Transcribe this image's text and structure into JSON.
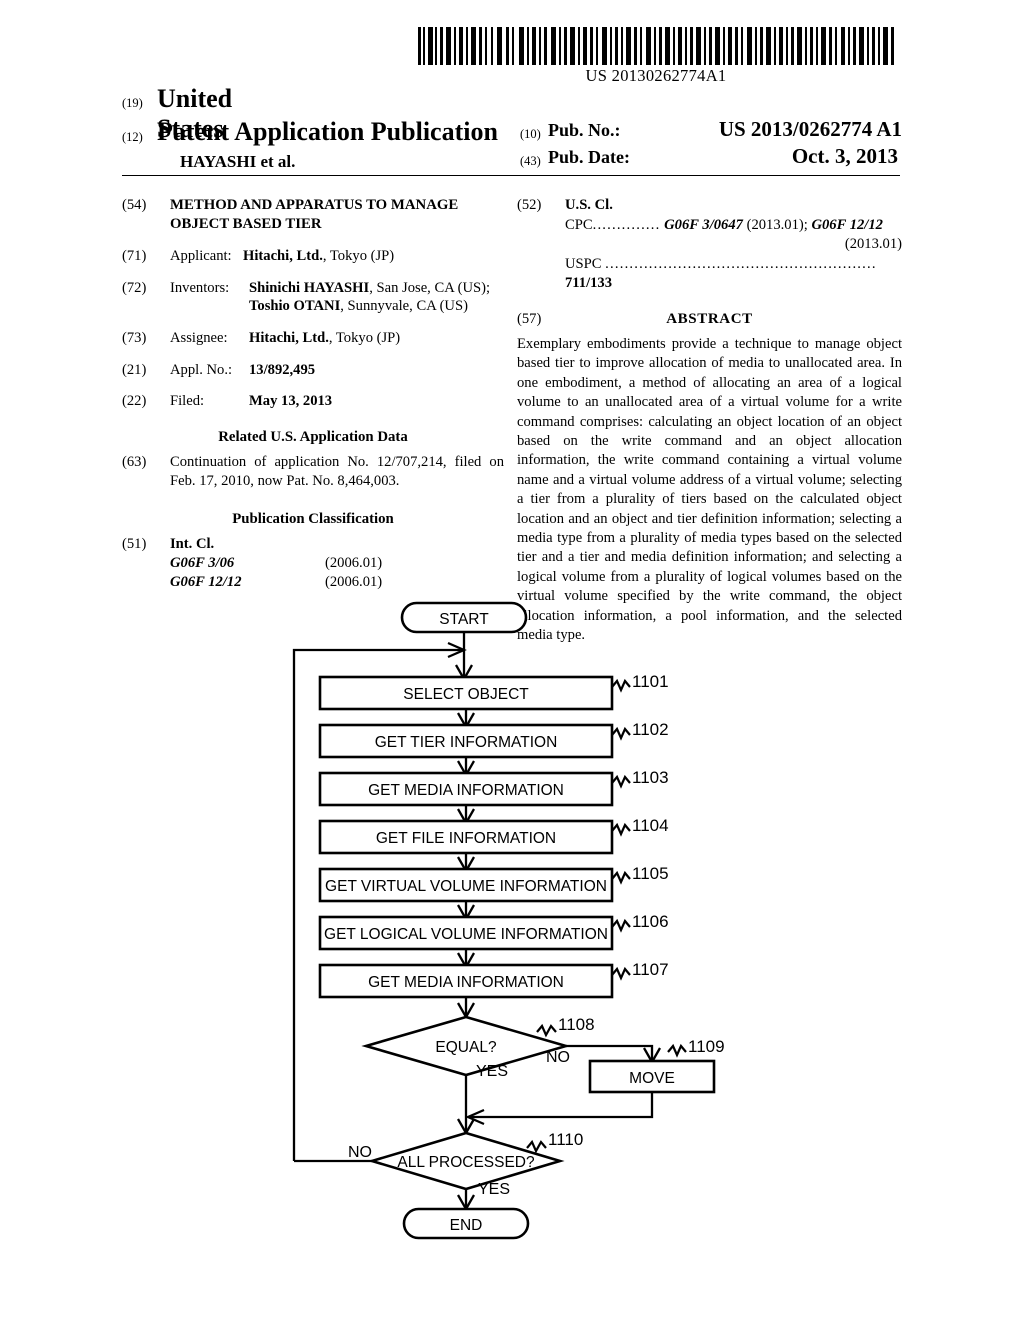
{
  "barcode": {
    "number": "US 20130262774A1",
    "icon": "barcode-icon"
  },
  "header": {
    "code_19": "(19)",
    "country": "United States",
    "code_12": "(12)",
    "doc_type": "Patent Application Publication",
    "authors": "HAYASHI et al.",
    "pub_no": {
      "code": "(10)",
      "label": "Pub. No.:",
      "value": "US 2013/0262774 A1"
    },
    "pub_date": {
      "code": "(43)",
      "label": "Pub. Date:",
      "value": "Oct. 3, 2013"
    }
  },
  "left_column": {
    "title": {
      "code": "(54)",
      "text": "METHOD AND APPARATUS TO MANAGE OBJECT BASED TIER"
    },
    "applicant": {
      "code": "(71)",
      "label": "Applicant:",
      "name": "Hitachi, Ltd.",
      "rest": ", Tokyo (JP)"
    },
    "inventors": {
      "code": "(72)",
      "label": "Inventors:",
      "line1_name": "Shinichi HAYASHI",
      "line1_rest": ", San Jose, CA (US);",
      "line2_name": "Toshio OTANI",
      "line2_rest": ", Sunnyvale, CA (US)"
    },
    "assignee": {
      "code": "(73)",
      "label": "Assignee:",
      "name": "Hitachi, Ltd.",
      "rest": ", Tokyo (JP)"
    },
    "appl_no": {
      "code": "(21)",
      "label": "Appl. No.:",
      "value": "13/892,495"
    },
    "filed": {
      "code": "(22)",
      "label": "Filed:",
      "value": "May 13, 2013"
    },
    "related_head": "Related U.S. Application Data",
    "related": {
      "code": "(63)",
      "text": "Continuation of application No. 12/707,214, filed on Feb. 17, 2010, now Pat. No. 8,464,003."
    },
    "pub_class_head": "Publication Classification",
    "int_cl": {
      "code": "(51)",
      "label": "Int. Cl.",
      "rows": [
        {
          "code": "G06F 3/06",
          "version": "(2006.01)"
        },
        {
          "code": "G06F 12/12",
          "version": "(2006.01)"
        }
      ]
    }
  },
  "right_column": {
    "us_cl": {
      "code": "(52)",
      "label": "U.S. Cl.",
      "cpc_label": "CPC",
      "cpc_dots": "..............",
      "cpc_value_1": "G06F 3/0647",
      "cpc_mid": " (2013.01); ",
      "cpc_value_2": "G06F 12/12",
      "cpc_line2": "(2013.01)",
      "uspc_label": "USPC",
      "uspc_dots": "........................................................",
      "uspc_value": "711/133"
    },
    "abstract": {
      "code": "(57)",
      "heading": "ABSTRACT",
      "text": "Exemplary embodiments provide a technique to manage object based tier to improve allocation of media to unallocated area. In one embodiment, a method of allocating an area of a logical volume to an unallocated area of a virtual volume for a write command comprises: calculating an object location of an object based on the write command and an object allocation information, the write command containing a virtual volume name and a virtual volume address of a virtual volume; selecting a tier from a plurality of tiers based on the calculated object location and an object and tier definition information; selecting a media type from a plurality of media types based on the selected tier and a tier and media definition information; and selecting a logical volume from a plurality of logical volumes based on the virtual volume specified by the write command, the object allocation information, a pool information, and the selected media type."
    }
  },
  "flowchart": {
    "start_label": "START",
    "end_label": "END",
    "steps": [
      {
        "ref": "1101",
        "label": "SELECT OBJECT"
      },
      {
        "ref": "1102",
        "label": "GET TIER INFORMATION"
      },
      {
        "ref": "1103",
        "label": "GET MEDIA INFORMATION"
      },
      {
        "ref": "1104",
        "label": "GET FILE INFORMATION"
      },
      {
        "ref": "1105",
        "label": "GET VIRTUAL VOLUME INFORMATION"
      },
      {
        "ref": "1106",
        "label": "GET LOGICAL VOLUME INFORMATION"
      },
      {
        "ref": "1107",
        "label": "GET MEDIA INFORMATION"
      }
    ],
    "decision_equal": {
      "ref": "1108",
      "label": "EQUAL?",
      "no": "NO",
      "yes": "YES"
    },
    "move": {
      "ref": "1109",
      "label": "MOVE"
    },
    "decision_all": {
      "ref": "1110",
      "label": "ALL PROCESSED?",
      "no": "NO",
      "yes": "YES"
    }
  }
}
